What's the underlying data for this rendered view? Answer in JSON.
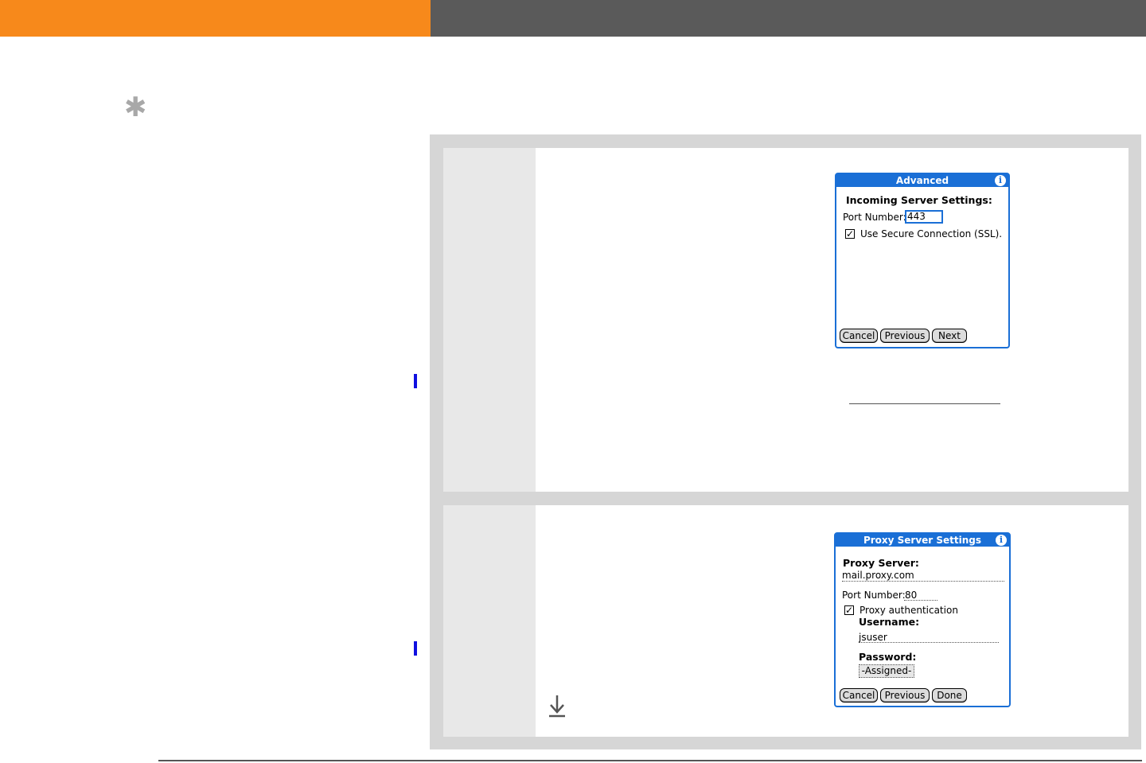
{
  "dialog_advanced": {
    "title": "Advanced",
    "info_glyph": "i",
    "section_label": "Incoming Server Settings:",
    "port_label": "Port Number:",
    "port_value": "443",
    "ssl_checked_glyph": "✓",
    "ssl_label": "Use Secure Connection (SSL).",
    "buttons": {
      "cancel": "Cancel",
      "previous": "Previous",
      "next": "Next"
    }
  },
  "dialog_proxy": {
    "title": "Proxy Server Settings",
    "info_glyph": "i",
    "proxy_server_label": "Proxy Server:",
    "proxy_server_value": "mail.proxy.com",
    "port_label": "Port Number:",
    "port_value": "80",
    "auth_checked_glyph": "✓",
    "auth_label": "Proxy authentication",
    "username_label": "Username:",
    "username_value": "jsuser",
    "password_label": "Password:",
    "password_value": "-Assigned-",
    "buttons": {
      "cancel": "Cancel",
      "previous": "Previous",
      "done": "Done"
    }
  },
  "icons": {
    "tip": "asterisk-icon",
    "continue": "arrow-down-icon",
    "tip_glyph": "✱"
  },
  "colors": {
    "header_orange": "#f7891b",
    "header_gray": "#5a5a5a",
    "dialog_blue": "#1a6fd6",
    "margin_bar_blue": "#1010e0"
  }
}
